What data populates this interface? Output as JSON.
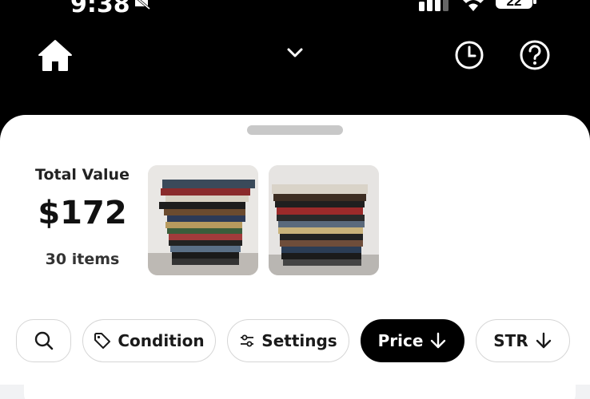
{
  "status_bar": {
    "time": "9:38",
    "battery_level": "22",
    "icons": [
      "bell-off-icon",
      "signal-icon",
      "wifi-icon",
      "battery-icon"
    ]
  },
  "nav": {
    "icons": [
      "home-icon",
      "chevron-down-icon",
      "history-icon",
      "help-icon"
    ]
  },
  "summary": {
    "total_label": "Total Value",
    "total_value": "$172",
    "item_count": "30 items"
  },
  "filters": {
    "condition_label": "Condition",
    "settings_label": "Settings",
    "price_label": "Price",
    "str_label": "STR",
    "active_filter": "Price",
    "icons": [
      "search-icon",
      "tag-icon",
      "sliders-icon",
      "arrow-down-icon"
    ]
  },
  "colors": {
    "background": "#000000",
    "sheet": "#ffffff",
    "active_chip": "#000000",
    "chip_border": "#d6d6d6"
  }
}
